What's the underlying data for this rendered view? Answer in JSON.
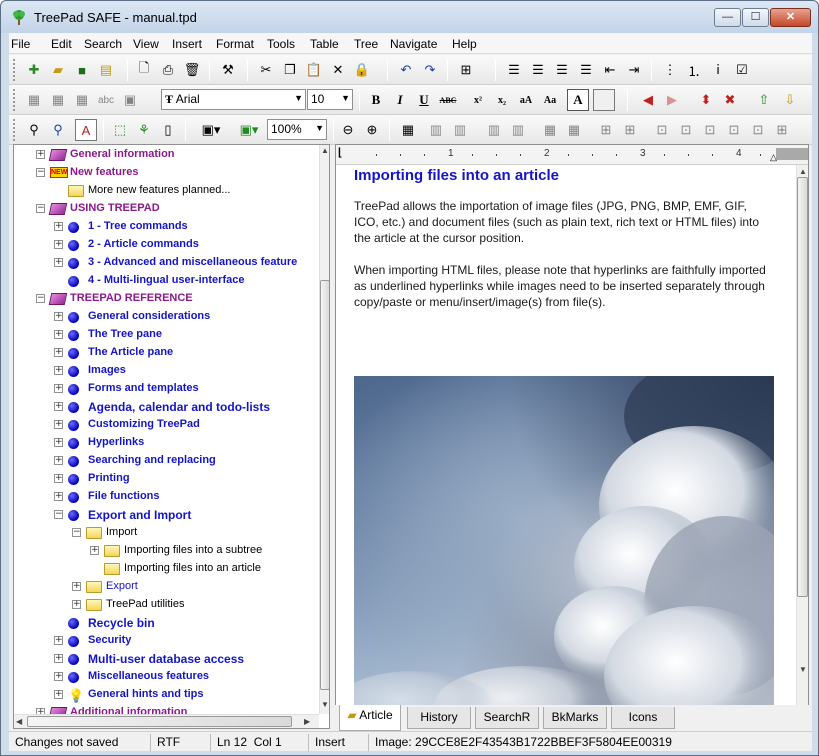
{
  "window": {
    "title": "TreePad SAFE - manual.tpd",
    "min_symbol": "—",
    "max_symbol": "☐",
    "close_symbol": "✕"
  },
  "menu": [
    "File",
    "Edit",
    "Search",
    "View",
    "Insert",
    "Format",
    "Tools",
    "Table",
    "Tree",
    "Navigate",
    "Help"
  ],
  "toolbar": {
    "font_name": "Arial",
    "font_size": "10",
    "zoom": "100%",
    "bold": "B",
    "italic": "I",
    "underline": "U",
    "abc": "ABC",
    "superscript": "x²",
    "subscript": "x₂",
    "case_lower": "aA",
    "case_upper": "Aa",
    "font_color_box": "A",
    "abc_spell": "abc"
  },
  "tree": {
    "items": [
      {
        "label": "General information",
        "style": "purple",
        "icon": "book-icon",
        "expander": "+"
      },
      {
        "label": "New features",
        "style": "purple",
        "icon": "new-icon",
        "expander": "-"
      },
      {
        "label": "More new features planned...",
        "style": "plain",
        "icon": "folder-icon",
        "expander": ""
      },
      {
        "label": "USING TREEPAD",
        "style": "purple",
        "icon": "book-icon",
        "expander": "-"
      },
      {
        "label": "1 - Tree commands",
        "style": "blue",
        "icon": "dot-icon",
        "expander": "+"
      },
      {
        "label": "2 - Article commands",
        "style": "blue",
        "icon": "dot-icon",
        "expander": "+"
      },
      {
        "label": "3 - Advanced and miscellaneous feature",
        "style": "blue",
        "icon": "dot-icon",
        "expander": "+"
      },
      {
        "label": "4 - Multi-lingual user-interface",
        "style": "blue",
        "icon": "dot-icon",
        "expander": ""
      },
      {
        "label": "TREEPAD REFERENCE",
        "style": "purple",
        "icon": "book-icon",
        "expander": "-"
      },
      {
        "label": "General considerations",
        "style": "blue",
        "icon": "dot-icon",
        "expander": "+"
      },
      {
        "label": "The Tree pane",
        "style": "blue",
        "icon": "dot-icon",
        "expander": "+"
      },
      {
        "label": "The Article pane",
        "style": "blue",
        "icon": "dot-icon",
        "expander": "+"
      },
      {
        "label": "Images",
        "style": "blue",
        "icon": "dot-icon",
        "expander": "+"
      },
      {
        "label": "Forms and templates",
        "style": "blue",
        "icon": "dot-icon",
        "expander": "+"
      },
      {
        "label": "Agenda, calendar and todo-lists",
        "style": "blue big",
        "icon": "dot-icon",
        "expander": "+"
      },
      {
        "label": "Customizing TreePad",
        "style": "blue",
        "icon": "dot-icon",
        "expander": "+"
      },
      {
        "label": "Hyperlinks",
        "style": "blue",
        "icon": "dot-icon",
        "expander": "+"
      },
      {
        "label": "Searching and replacing",
        "style": "blue",
        "icon": "dot-icon",
        "expander": "+"
      },
      {
        "label": "Printing",
        "style": "blue",
        "icon": "dot-icon",
        "expander": "+"
      },
      {
        "label": "File functions",
        "style": "blue",
        "icon": "dot-icon",
        "expander": "+"
      },
      {
        "label": "Export and Import",
        "style": "blue big",
        "icon": "dot-icon",
        "expander": "-"
      },
      {
        "label": "Import",
        "style": "plain",
        "icon": "folder-icon",
        "expander": "-"
      },
      {
        "label": "Importing files into a subtree",
        "style": "plain",
        "icon": "folder-icon",
        "expander": "+"
      },
      {
        "label": "Importing files into an article",
        "style": "plain",
        "icon": "folder-icon",
        "expander": ""
      },
      {
        "label": "Export",
        "style": "plain-blue",
        "icon": "folder-icon",
        "expander": "+"
      },
      {
        "label": "TreePad utilities",
        "style": "plain",
        "icon": "folder-icon",
        "expander": "+"
      },
      {
        "label": "Recycle bin",
        "style": "blue big",
        "icon": "dot-icon",
        "expander": ""
      },
      {
        "label": "Security",
        "style": "blue",
        "icon": "dot-icon",
        "expander": "+"
      },
      {
        "label": "Multi-user database access",
        "style": "blue big",
        "icon": "dot-icon",
        "expander": "+"
      },
      {
        "label": "Miscellaneous features",
        "style": "blue",
        "icon": "dot-icon",
        "expander": "+"
      },
      {
        "label": "General hints and tips",
        "style": "blue",
        "icon": "bulb-icon",
        "expander": "+"
      },
      {
        "label": "Additional information",
        "style": "purple",
        "icon": "book-icon",
        "expander": "+"
      }
    ]
  },
  "article": {
    "title": "Importing files into an article",
    "paragraphs": [
      "TreePad allows the importation of image files (JPG, PNG, BMP, EMF, GIF, ICO, etc.) and document files (such as plain text, rich text or HTML files) into the article at the cursor position.",
      "When importing HTML files, please note that hyperlinks are faithfully imported as underlined hyperlinks while images need to be inserted separately through copy/paste or menu/insert/image(s) from file(s)."
    ],
    "ruler_numbers": [
      "1",
      "2",
      "3",
      "4"
    ]
  },
  "tabs": [
    "Article",
    "History",
    "SearchR",
    "BkMarks",
    "Icons"
  ],
  "status": {
    "saved": "Changes not saved",
    "format": "RTF",
    "position": "Ln 12  Col 1",
    "mode": "Insert",
    "image": "Image: 29CCE8E2F43543B1722BBEF3F5804EE00319"
  }
}
